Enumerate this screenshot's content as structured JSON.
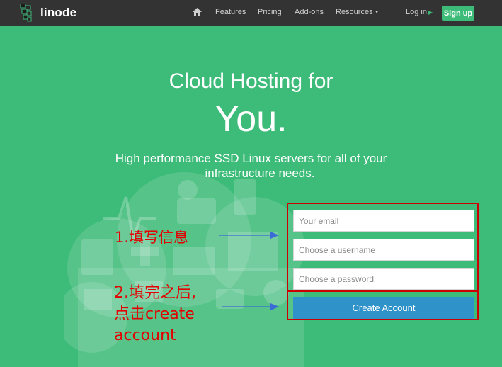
{
  "navbar": {
    "brand": "linode",
    "items": [
      {
        "label": "Features"
      },
      {
        "label": "Pricing"
      },
      {
        "label": "Add-ons"
      },
      {
        "label": "Resources"
      },
      {
        "label": "Log in"
      }
    ],
    "signup_label": "Sign up"
  },
  "hero": {
    "title_line1": "Cloud Hosting for",
    "title_line2": "You.",
    "subtitle_line1": "High performance SSD Linux servers for all of your",
    "subtitle_line2": "infrastructure needs."
  },
  "form": {
    "email_placeholder": "Your email",
    "username_placeholder": "Choose a username",
    "password_placeholder": "Choose a password",
    "submit_label": "Create Account"
  },
  "annotations": {
    "step1": "1.填写信息",
    "step2_line1": "2.填完之后,",
    "step2_line2": "点击create",
    "step2_line3": "account"
  },
  "colors": {
    "brand_green": "#3dbb78",
    "navbar_bg": "#333333",
    "button_blue": "#2f92c9",
    "annotation_red": "#e30000"
  }
}
